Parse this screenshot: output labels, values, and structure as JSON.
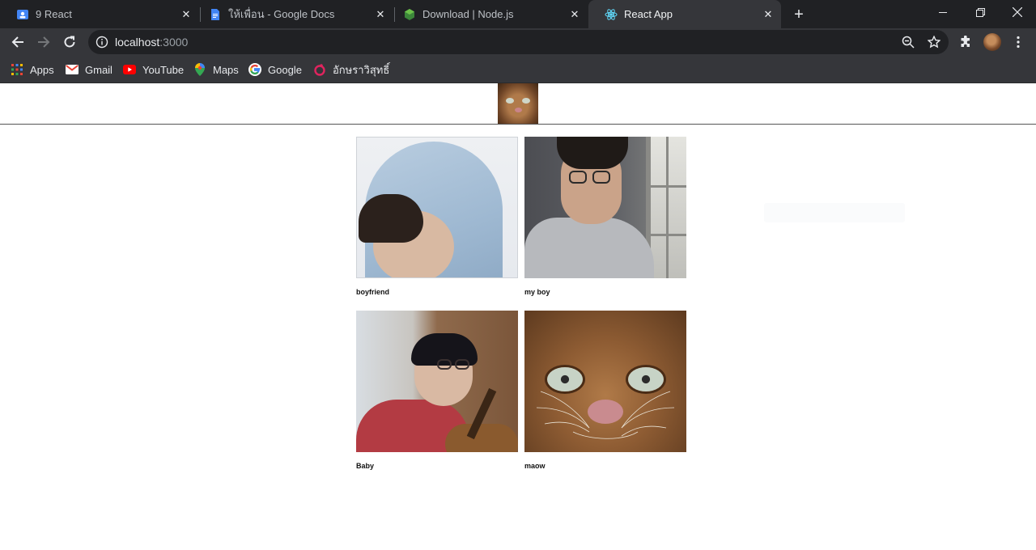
{
  "browser": {
    "tabs": [
      {
        "title": "9 React",
        "icon": "classroom-icon"
      },
      {
        "title": "ให้เพื่อน - Google Docs",
        "icon": "google-docs-icon"
      },
      {
        "title": "Download | Node.js",
        "icon": "nodejs-icon"
      },
      {
        "title": "React App",
        "icon": "react-icon",
        "active": true
      }
    ],
    "url_host": "localhost",
    "url_port": ":3000",
    "bookmarks": [
      {
        "label": "Apps",
        "icon": "apps-grid-icon"
      },
      {
        "label": "Gmail",
        "icon": "gmail-icon"
      },
      {
        "label": "YouTube",
        "icon": "youtube-icon"
      },
      {
        "label": "Maps",
        "icon": "maps-icon"
      },
      {
        "label": "Google",
        "icon": "google-icon"
      },
      {
        "label": "อักษราวิสุทธิ์",
        "icon": "bookmark-site-icon"
      }
    ]
  },
  "app": {
    "logo_icon": "cat-logo-icon",
    "photos": [
      {
        "caption": "boyfriend"
      },
      {
        "caption": "my boy"
      },
      {
        "caption": "Baby"
      },
      {
        "caption": "maow"
      }
    ]
  },
  "colors": {
    "tab_bar": "#202124",
    "toolbar": "#35363a",
    "page_background": "#ffffff"
  }
}
